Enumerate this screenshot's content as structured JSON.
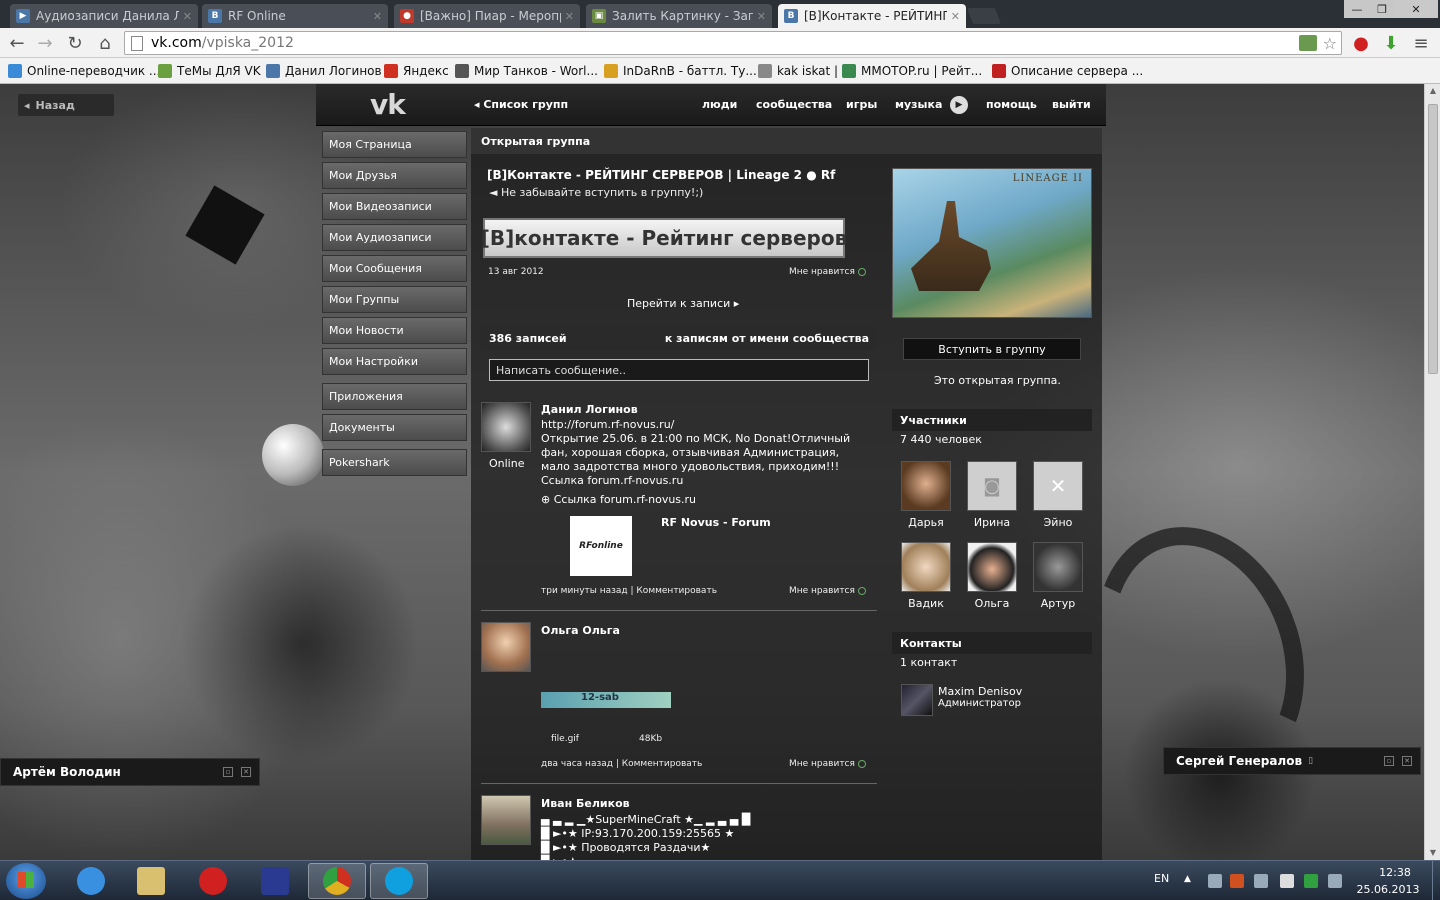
{
  "browser": {
    "tabs": [
      {
        "title": "Аудиозаписи Данила Ло",
        "icon": "play-icon",
        "icon_color": "#4a76a8",
        "active": false
      },
      {
        "title": "RF Online",
        "icon": "vk-icon",
        "icon_color": "#4a76a8",
        "active": false
      },
      {
        "title": "[Важно] Пиар - Меропри",
        "icon": "fire-icon",
        "icon_color": "#c0392b",
        "active": false
      },
      {
        "title": "Залить Картинку - Загру",
        "icon": "image-icon",
        "icon_color": "#6a8a40",
        "active": false
      },
      {
        "title": "[В]Контакте - РЕЙТИНГ С",
        "icon": "vk-icon",
        "icon_color": "#4a76a8",
        "active": true
      }
    ],
    "window_controls": {
      "minimize": "—",
      "maximize": "❐",
      "close": "✕"
    },
    "url_host": "vk.com",
    "url_path": "/vpiska_2012",
    "bookmarks": [
      {
        "label": "Online-переводчик ...",
        "icon_color": "#3a8ad8"
      },
      {
        "label": "ТеМы ДлЯ VK",
        "icon_color": "#6aa040"
      },
      {
        "label": "Данил Логинов",
        "icon_color": "#4a76a8"
      },
      {
        "label": "Яндекс",
        "icon_color": "#d03020"
      },
      {
        "label": "Мир Танков - Worl...",
        "icon_color": "#555555"
      },
      {
        "label": "InDaRnB - баттл. Ту...",
        "icon_color": "#d8a020"
      },
      {
        "label": "kak iskat |",
        "icon_color": "#888888"
      },
      {
        "label": "MMOTOP.ru | Рейт...",
        "icon_color": "#3a8a50"
      },
      {
        "label": "Описание сервера ...",
        "icon_color": "#c02020"
      }
    ]
  },
  "vk": {
    "back_label": "Назад",
    "logo": "vk",
    "group_list_link": "Список групп",
    "top_nav": [
      "люди",
      "сообщества",
      "игры",
      "музыка",
      "помощь",
      "выйти"
    ],
    "left_menu": [
      "Моя Страница",
      "Мои Друзья",
      "Мои Видеозаписи",
      "Мои Аудиозаписи",
      "Мои Сообщения",
      "Мои Группы",
      "Мои Новости",
      "Мои Настройки",
      "Приложения",
      "Документы",
      "Pokershark"
    ],
    "group": {
      "type_label": "Открытая группа",
      "title": "[В]Контакте - РЕЙТИНГ СЕРВЕРОВ | Lineage 2 ● Rf",
      "status": "◄ Не забывайте вступить в группу!;)",
      "banner_text": "[В]контакте - Рейтинг серверов",
      "pinned_date": "13 авг 2012",
      "like_label": "Мне нравится",
      "go_to_post": "Перейти к записи",
      "records_count": "386 записей",
      "community_posts_link": "к записям от имени сообщества",
      "compose_placeholder": "Написать сообщение..",
      "cover_logo": "LINEAGE II",
      "join_button": "Вступить в группу",
      "open_group_note": "Это открытая группа.",
      "members_title": "Участники",
      "members_count": "7 440 человек",
      "members": [
        {
          "name": "Дарья",
          "color": "#8a6a50"
        },
        {
          "name": "Ирина",
          "color": "#cfcfcf"
        },
        {
          "name": "Эйно",
          "color": "#cfcfcf"
        },
        {
          "name": "Вадик",
          "color": "#d8c0a0"
        },
        {
          "name": "Ольга",
          "color": "#c89070"
        },
        {
          "name": "Артур",
          "color": "#707070"
        }
      ],
      "contacts_title": "Контакты",
      "contacts_count": "1 контакт",
      "contact_name": "Maxim Denisov",
      "contact_role": "Администратор"
    },
    "posts": [
      {
        "author": "Данил Логинов",
        "online": "Online",
        "link": "http://forum.rf-novus.ru/",
        "text": "Открытие 25.06. в 21:00 по МСК, No Donat!Отличный фан, хорошая сборка, отзывчивая Администрация, мало задротства много удовольствия, приходим!!!",
        "text2": "Ссылка forum.rf-novus.ru",
        "attachment_link": "Ссылка forum.rf-novus.ru",
        "preview_logo": "RFonline",
        "preview_title": "RF Novus - Forum",
        "time": "три минуты назад",
        "comment": "Комментировать",
        "like": "Мне нравится"
      },
      {
        "author": "Ольга Ольга",
        "gif_label": "12-sab",
        "file_name": "file.gif",
        "file_size": "48Kb",
        "time": "два часа назад",
        "comment": "Комментировать",
        "like": "Мне нравится"
      },
      {
        "author": "Иван Беликов",
        "line1": "▄ ▃ ▂ ▁★SuperMineCraft ★▁ ▂ ▃ ▄ █",
        "line2": "█ ►•★ IP:93.170.200.159:25565 ★",
        "line3": "█ ►•★ Проводятся Раздачи★",
        "line4": "█ ►•★"
      }
    ],
    "chat_left": "Артём Володин",
    "chat_right": "Сергей Генералов"
  },
  "taskbar": {
    "apps": [
      {
        "name": "ie",
        "color": "#3a90e0"
      },
      {
        "name": "explorer",
        "color": "#d8c070"
      },
      {
        "name": "opera",
        "color": "#d02020"
      },
      {
        "name": "save",
        "color": "#2a3a90"
      },
      {
        "name": "chrome",
        "color": "#e0b020"
      },
      {
        "name": "skype",
        "color": "#10a0e0"
      }
    ],
    "lang": "EN",
    "time": "12:38",
    "date": "25.06.2013"
  }
}
